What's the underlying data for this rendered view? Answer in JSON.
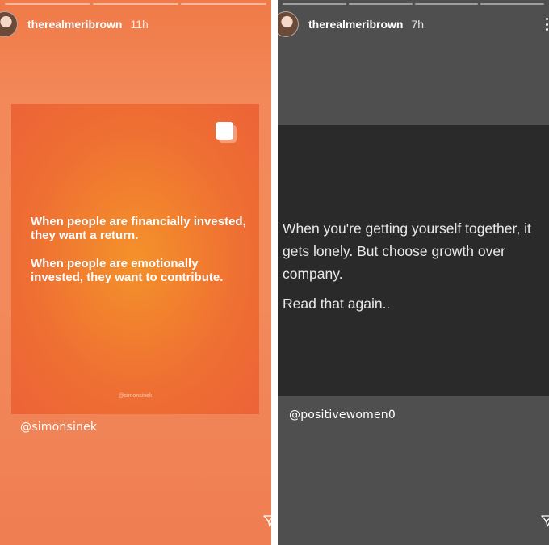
{
  "stories": [
    {
      "username": "therealmeribrown",
      "time": "11h",
      "quote_lines": [
        "When people are financially invested, they want a return.",
        "When people are emotionally invested, they want to contribute."
      ],
      "card_credit": "@simonsinek",
      "mention": "@simonsinek",
      "colors": {
        "background": "#f28a5b",
        "card": "#ef6f33"
      }
    },
    {
      "username": "therealmeribrown",
      "time": "7h",
      "quote_lines": [
        "When you're getting yourself together, it gets lonely. But choose growth over company.",
        "Read that again.."
      ],
      "mention": "@positivewomen0",
      "colors": {
        "background": "#4f4f4f",
        "band": "#2a2a2a"
      }
    }
  ],
  "icons": {
    "avatar": "profile-avatar",
    "multi_image": "stack-icon",
    "more": "more-icon",
    "send": "send-icon"
  }
}
